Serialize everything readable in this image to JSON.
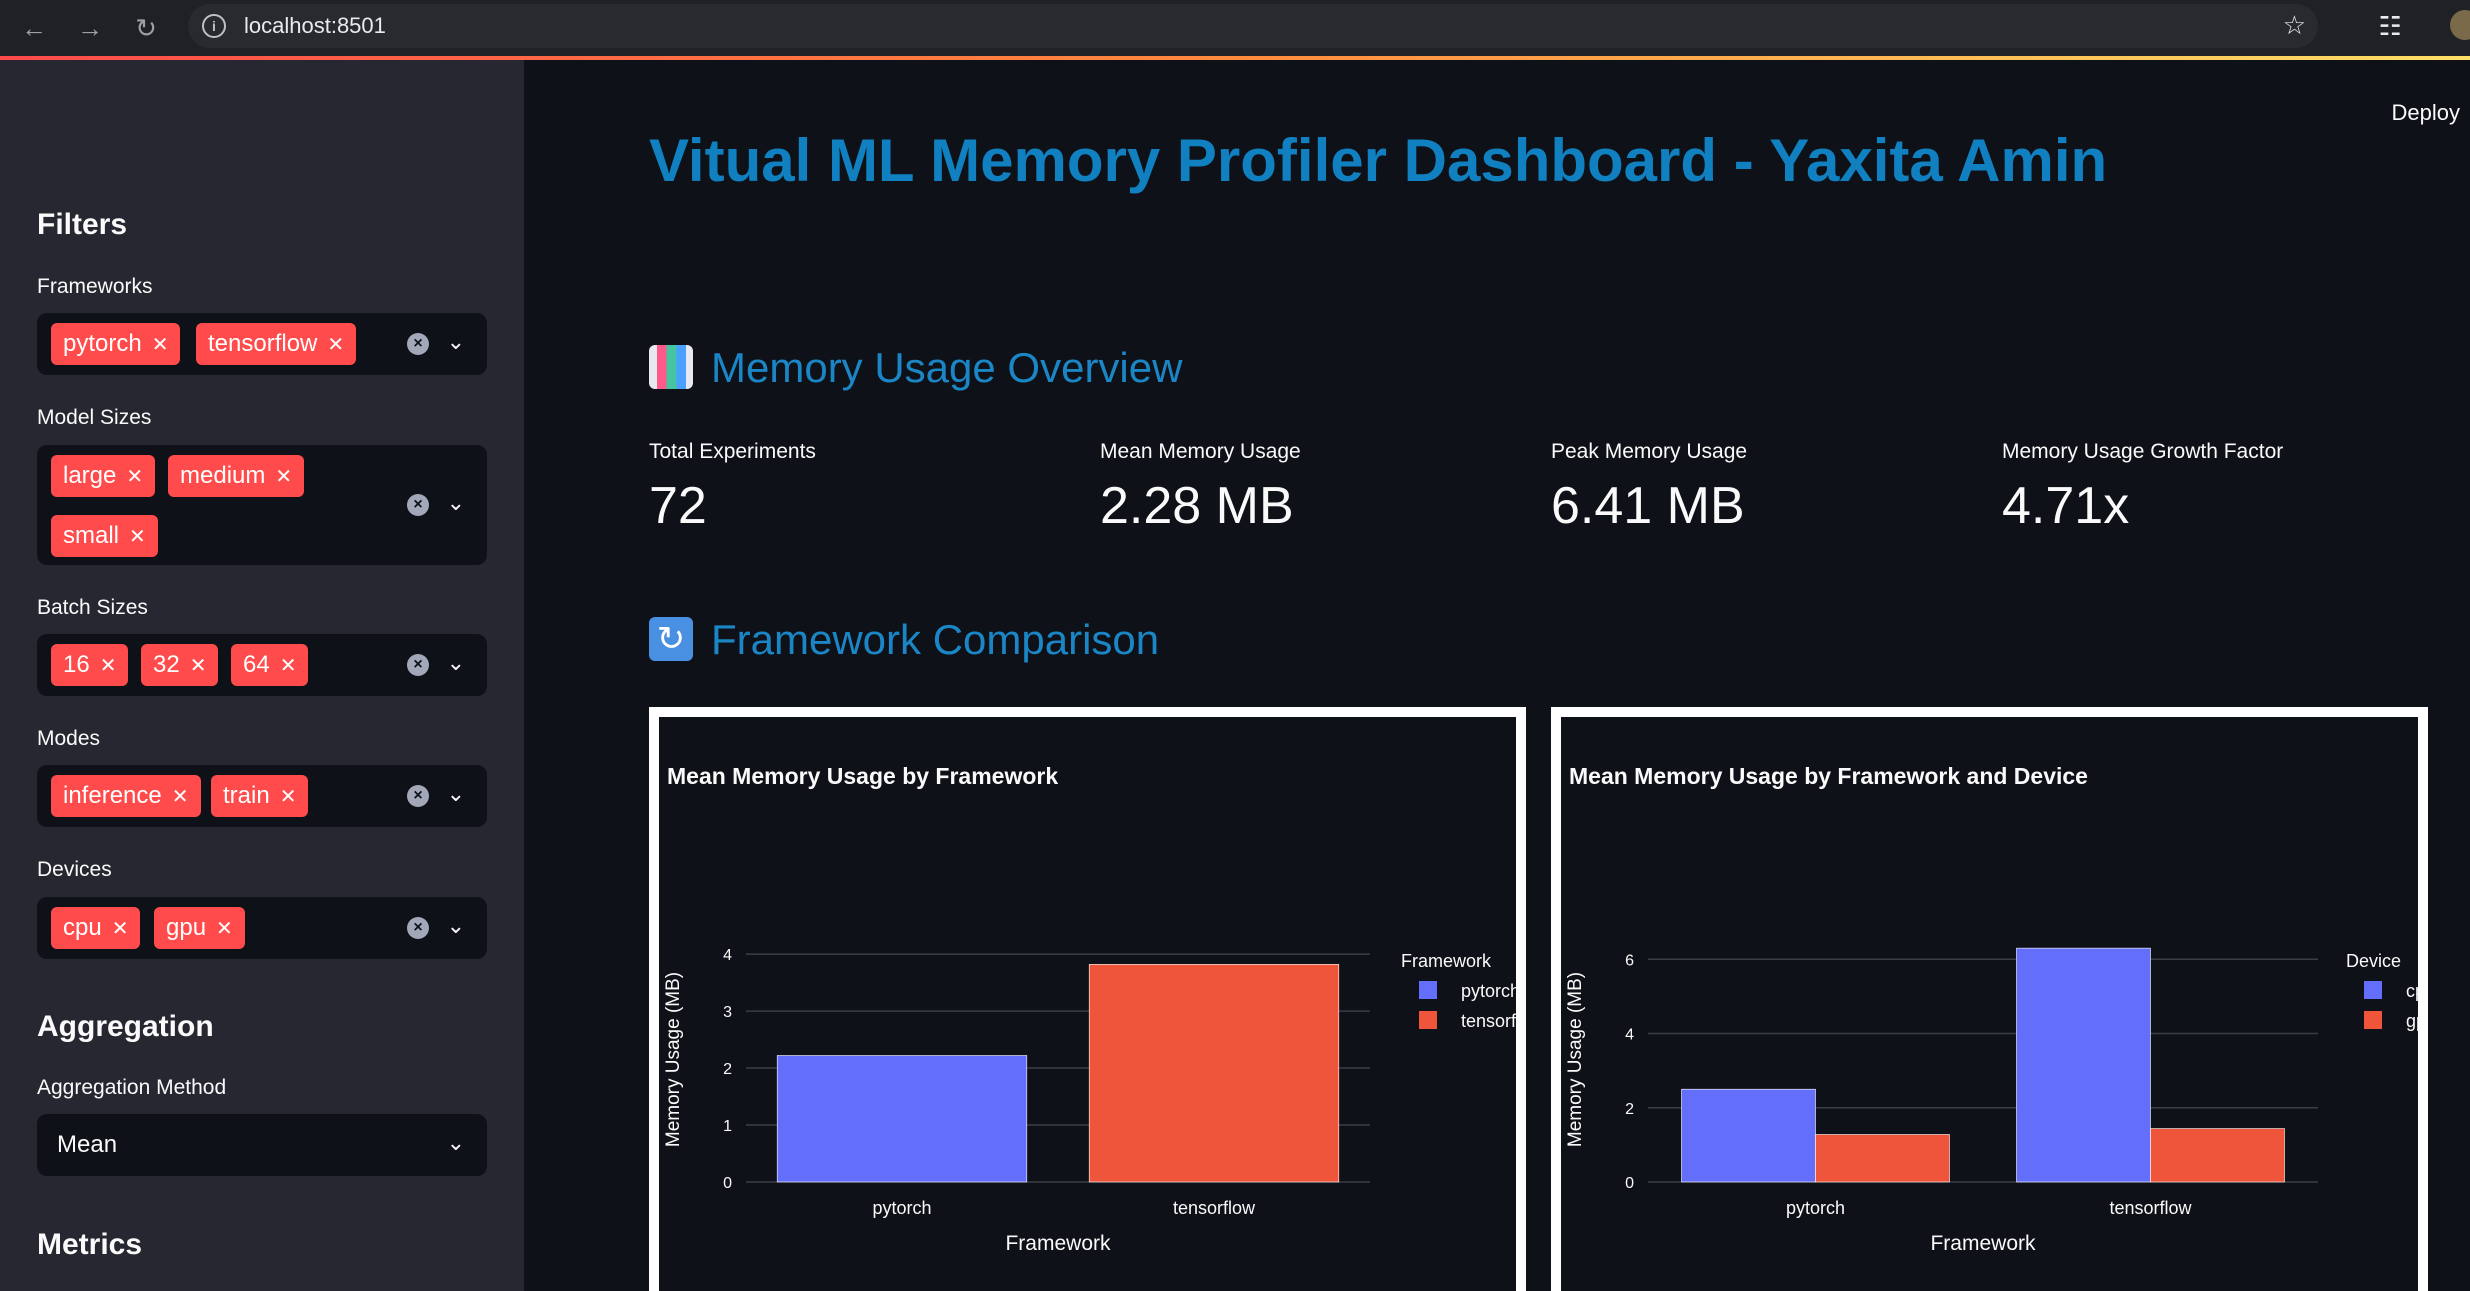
{
  "browser": {
    "url": "localhost:8501"
  },
  "sidebar": {
    "filters_heading": "Filters",
    "frameworks": {
      "label": "Frameworks",
      "chips": [
        "pytorch",
        "tensorflow"
      ]
    },
    "model_sizes": {
      "label": "Model Sizes",
      "chips": [
        "large",
        "medium",
        "small"
      ]
    },
    "batch_sizes": {
      "label": "Batch Sizes",
      "chips": [
        "16",
        "32",
        "64"
      ]
    },
    "modes": {
      "label": "Modes",
      "chips": [
        "inference",
        "train"
      ]
    },
    "devices": {
      "label": "Devices",
      "chips": [
        "cpu",
        "gpu"
      ]
    },
    "aggregation_heading": "Aggregation",
    "aggregation_method": {
      "label": "Aggregation Method",
      "value": "Mean"
    },
    "metrics_heading": "Metrics"
  },
  "header": {
    "deploy_label": "Deploy"
  },
  "main": {
    "title": "Vitual ML Memory Profiler Dashboard - Yaxita Amin",
    "overview_heading": "Memory Usage Overview",
    "metrics": [
      {
        "label": "Total Experiments",
        "value": "72"
      },
      {
        "label": "Mean Memory Usage",
        "value": "2.28 MB"
      },
      {
        "label": "Peak Memory Usage",
        "value": "6.41 MB"
      },
      {
        "label": "Memory Usage Growth Factor",
        "value": "4.71x"
      }
    ],
    "comparison_heading": "Framework Comparison"
  },
  "colors": {
    "accent": "#ff4b4b",
    "heading": "#1b86c6",
    "series1": "#636efa",
    "series2": "#ef553b"
  },
  "chart_data": [
    {
      "type": "bar",
      "title": "Mean Memory Usage by Framework",
      "xlabel": "Framework",
      "ylabel": "Memory Usage (MB)",
      "categories": [
        "pytorch",
        "tensorflow"
      ],
      "values": [
        2.22,
        3.82
      ],
      "ylim": [
        0,
        4.3
      ],
      "yticks": [
        0,
        1,
        2,
        3,
        4
      ],
      "legend_title": "Framework",
      "legend": [
        "pytorch",
        "tensorflow"
      ],
      "grid": true
    },
    {
      "type": "bar",
      "title": "Mean Memory Usage by Framework and Device",
      "xlabel": "Framework",
      "ylabel": "Memory Usage (MB)",
      "categories": [
        "pytorch",
        "tensorflow"
      ],
      "series": [
        {
          "name": "cpu",
          "values": [
            2.5,
            6.3
          ]
        },
        {
          "name": "gpu",
          "values": [
            1.28,
            1.44
          ]
        }
      ],
      "ylim": [
        0,
        6.6
      ],
      "yticks": [
        0,
        2,
        4,
        6
      ],
      "legend_title": "Device",
      "grid": true
    }
  ]
}
